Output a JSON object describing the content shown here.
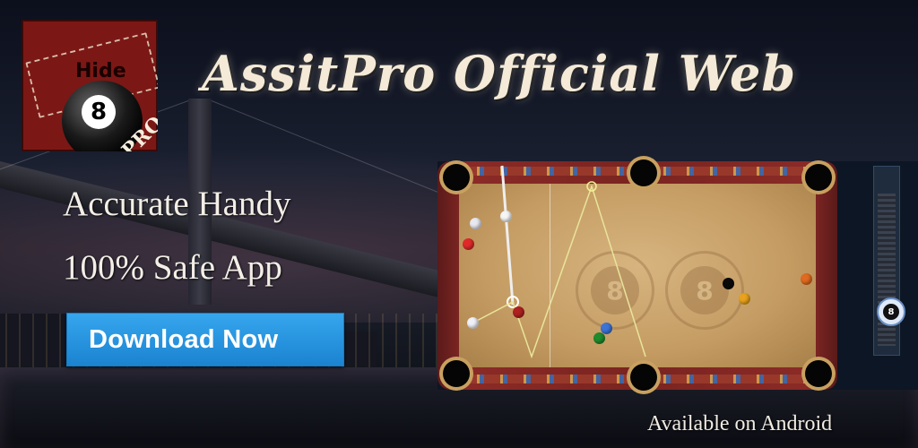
{
  "app_icon": {
    "top_label": "Hide",
    "ball_number": "8",
    "corner_label": "PRO"
  },
  "headline": "AssitPro Official Web",
  "features": [
    "Accurate Handy",
    "100% Safe App"
  ],
  "download_button": {
    "label": "Download Now",
    "color": "#2196e6"
  },
  "footer_note": "Available on Android",
  "game_screenshot": {
    "emblem_number": "8",
    "side_ball_number": "8"
  }
}
